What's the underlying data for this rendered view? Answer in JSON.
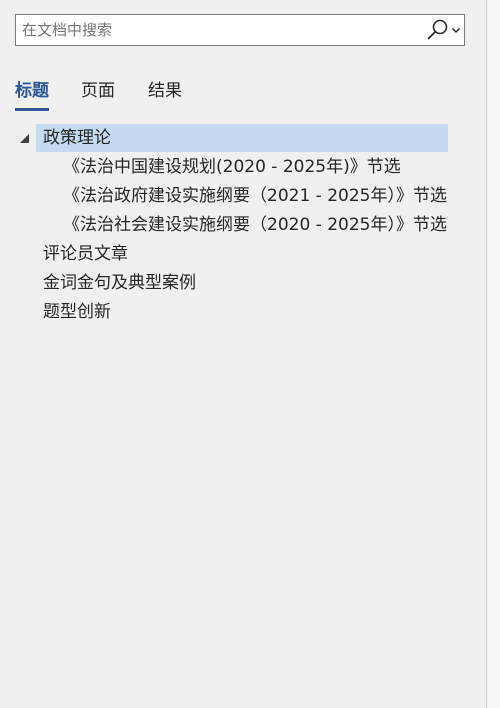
{
  "search": {
    "placeholder": "在文档中搜索",
    "value": "",
    "search_icon": "magnifier-icon",
    "dropdown_icon": "chevron-down-icon"
  },
  "tabs": [
    {
      "label": "标题",
      "active": true
    },
    {
      "label": "页面",
      "active": false
    },
    {
      "label": "结果",
      "active": false
    }
  ],
  "headings": [
    {
      "label": "政策理论",
      "level": 1,
      "expanded": true,
      "selected": true
    },
    {
      "label": "《法治中国建设规划(2020 - 2025年)》节选",
      "level": 2
    },
    {
      "label": "《法治政府建设实施纲要（2021 - 2025年）》节选",
      "level": 2
    },
    {
      "label": "《法治社会建设实施纲要（2020 - 2025年）》节选",
      "level": 2
    },
    {
      "label": "评论员文章",
      "level": 1
    },
    {
      "label": "金词金句及典型案例",
      "level": 1
    },
    {
      "label": "题型创新",
      "level": 1
    }
  ],
  "colors": {
    "accent": "#2b579a",
    "selection": "#c5d9f1",
    "background": "#f0f0f0"
  }
}
